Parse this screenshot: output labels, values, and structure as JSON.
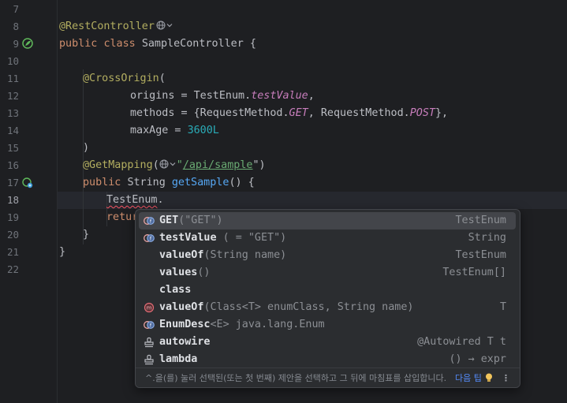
{
  "editor": {
    "line_numbers": [
      "7",
      "8",
      "9",
      "10",
      "11",
      "12",
      "13",
      "14",
      "15",
      "16",
      "17",
      "18",
      "19",
      "20",
      "21",
      "22"
    ],
    "current_line": "18",
    "code": {
      "l8_annotation": "@RestController",
      "l9_public": "public",
      "l9_class": "class",
      "l9_name": "SampleController {",
      "l11_annotation": "@CrossOrigin",
      "l11_paren": "(",
      "l12_key": "origins = TestEnum.",
      "l12_val": "testValue",
      "l12_end": ",",
      "l13_key": "methods = {RequestMethod.",
      "l13_get": "GET",
      "l13_mid": ", RequestMethod.",
      "l13_post": "POST",
      "l13_end": "},",
      "l14_key": "maxAge = ",
      "l14_val": "3600L",
      "l15": ")",
      "l16_annotation": "@GetMapping",
      "l16_paren": "(",
      "l16_quote1": "\"",
      "l16_url": "/api/sample",
      "l16_quote2": "\")",
      "l17_public": "public",
      "l17_type": "String",
      "l17_fn": "getSample",
      "l17_end": "() {",
      "l18_ref": "TestEnum",
      "l18_dot": ".",
      "l19_return": "retur",
      "l20": "}",
      "l21": "}"
    }
  },
  "completion": {
    "items": [
      {
        "name": "GET",
        "tail": "(\"GET\")",
        "type": "TestEnum",
        "icon": "enum-constant-icon",
        "selected": true
      },
      {
        "name": "testValue",
        "tail": " ( = \"GET\")",
        "type": "String",
        "icon": "enum-constant-icon",
        "selected": false
      },
      {
        "name": "valueOf",
        "tail": "(String name)",
        "type": "TestEnum",
        "icon": "none",
        "selected": false
      },
      {
        "name": "values",
        "tail": "()",
        "type": "TestEnum[]",
        "icon": "none",
        "selected": false
      },
      {
        "name": "class",
        "tail": "",
        "type": "",
        "icon": "none",
        "selected": false
      },
      {
        "name": "valueOf",
        "tail": "(Class<T> enumClass, String name)",
        "type": "T",
        "icon": "method-icon",
        "selected": false
      },
      {
        "name": "EnumDesc",
        "tail": "<E> java.lang.Enum",
        "type": "",
        "icon": "enum-constant-icon",
        "selected": false
      },
      {
        "name": "autowire",
        "tail": "",
        "type": "@Autowired T t",
        "icon": "stamp-icon",
        "selected": false
      },
      {
        "name": "lambda",
        "tail": "",
        "type": "() → expr",
        "icon": "stamp-icon",
        "selected": false
      }
    ],
    "footer_hint": "^.을(를) 눌러 선택된(또는 첫 번째) 제안을 선택하고 그 뒤에 마침표를 삽입합니다.",
    "footer_tip": "다음 팁",
    "footer_more": "⋮"
  },
  "colors": {
    "background": "#1e1f22",
    "annotation": "#b3ae60",
    "keyword": "#cf8e6d",
    "function": "#56a8f5",
    "static_field": "#c77dbb",
    "number": "#2aacb8",
    "string": "#6aab73"
  }
}
